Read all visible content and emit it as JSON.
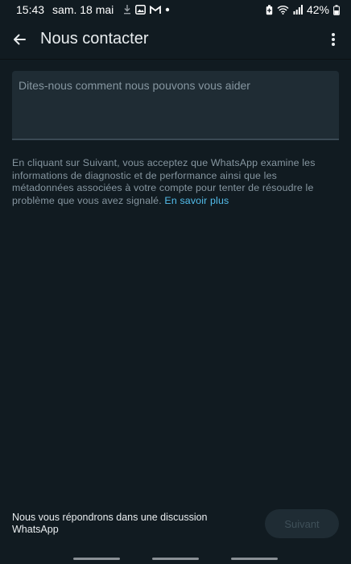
{
  "status_bar": {
    "time": "15:43",
    "date": "sam. 18 mai",
    "battery": "42%",
    "icons_left": [
      "download-icon",
      "image-icon",
      "gmail-icon",
      "dot-icon"
    ],
    "icons_right": [
      "battery-saver-icon",
      "wifi-icon",
      "signal-icon",
      "battery-icon"
    ]
  },
  "app_bar": {
    "title": "Nous contacter",
    "back_icon": "arrow-left-icon",
    "menu_icon": "more-vertical-icon"
  },
  "form": {
    "message_placeholder": "Dites-nous comment nous pouvons vous aider",
    "message_value": ""
  },
  "disclaimer": {
    "text": "En cliquant sur Suivant, vous acceptez que WhatsApp examine les informations de diagnostic et de performance ainsi que les métadonnées associées à votre compte pour tenter de résoudre le problème que vous avez signalé.",
    "link": "En savoir plus"
  },
  "footer": {
    "note": "Nous vous répondrons dans une discussion WhatsApp",
    "next_label": "Suivant"
  },
  "colors": {
    "background": "#111b21",
    "field": "#1f2c34",
    "link": "#53bdeb",
    "muted_text": "#8696a0"
  }
}
